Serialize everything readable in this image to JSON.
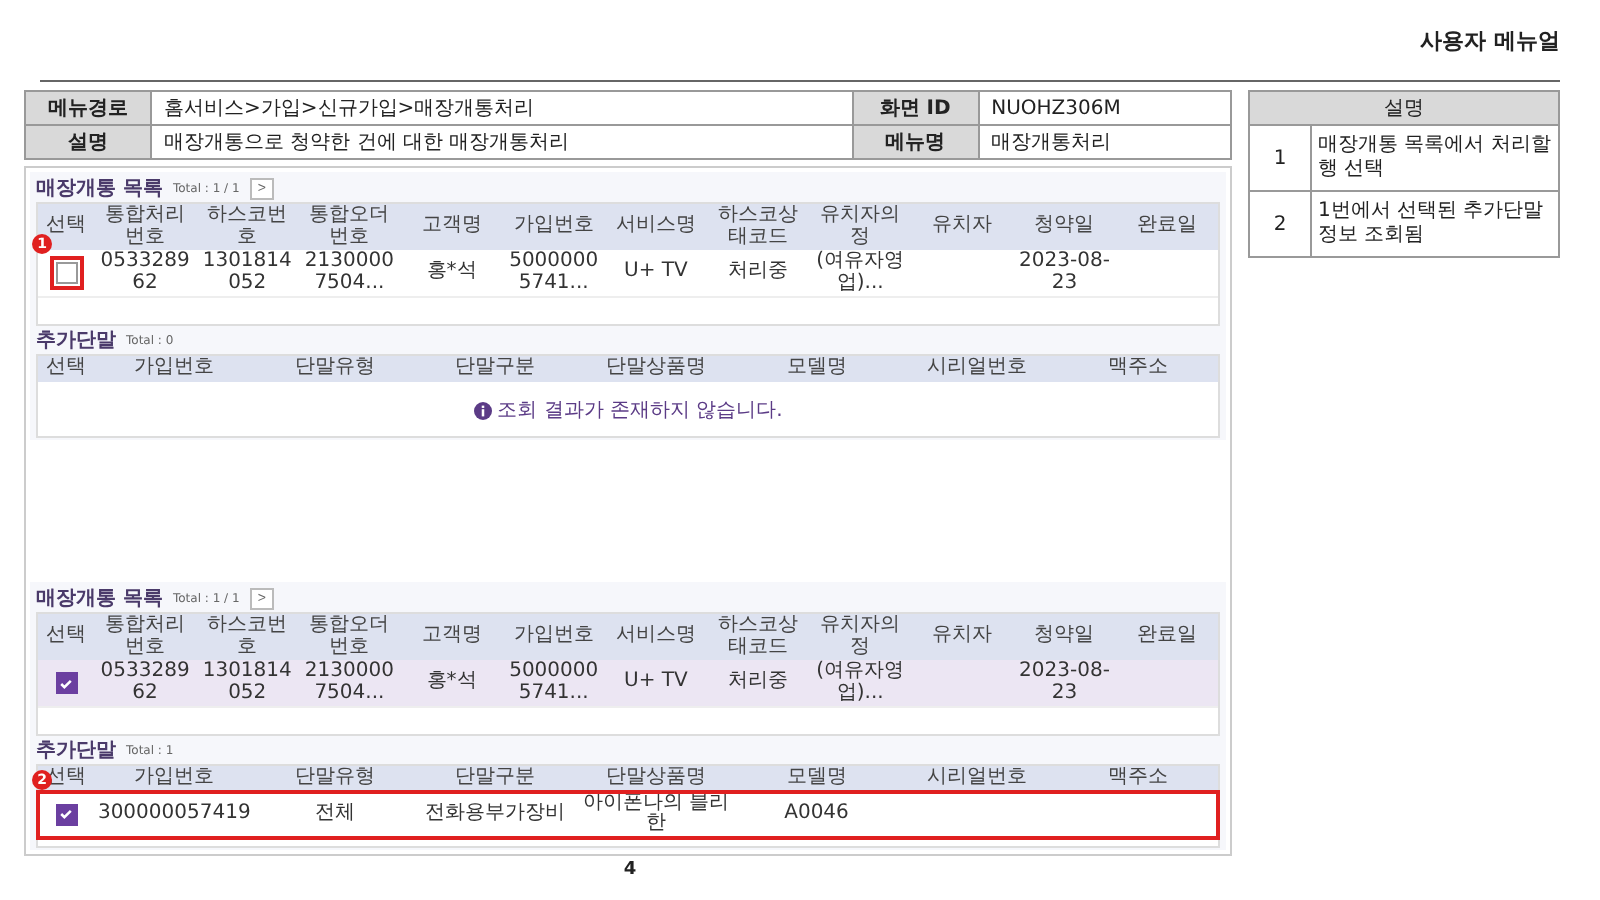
{
  "header": {
    "title": "사용자 메뉴얼"
  },
  "info": {
    "rows": [
      {
        "label": "메뉴경로",
        "value": "홈서비스>가입>신규가입>매장개통처리",
        "label2": "화면 ID",
        "value2": "NUOHZ306M"
      },
      {
        "label": "설명",
        "value": "매장개통으로 청약한 건에 대한 매장개통처리",
        "label2": "메뉴명",
        "value2": "매장개통처리"
      }
    ]
  },
  "notes": {
    "title": "설명",
    "rows": [
      {
        "number": "1",
        "text": "매장개통 목록에서 처리할 행 선택"
      },
      {
        "number": "2",
        "text": "1번에서 선택된 추가단말 정보 조회됨"
      }
    ]
  },
  "screens": [
    {
      "panels": [
        {
          "title": "매장개통 목록",
          "total": "Total : 1 / 1",
          "pager": ">",
          "columns": [
            "선택",
            "통합처리번호",
            "하스코번호",
            "통합오더번호",
            "고객명",
            "가입번호",
            "서비스명",
            "하스코상태코드",
            "유치자의정",
            "유치자",
            "청약일",
            "완료일"
          ],
          "rows": [
            {
              "checked": false,
              "selected": false,
              "checkbox_highlighted": true,
              "row_highlighted": false,
              "callout": "1",
              "cells": [
                "",
                "053328962",
                "1301814052",
                "21300007504...",
                "홍*석",
                "50000005741...",
                "U+ TV",
                "처리중",
                "(여유자영업)...",
                "",
                "2023-08-23",
                ""
              ]
            }
          ]
        },
        {
          "title": "추가단말",
          "total": "Total : 0",
          "columns": [
            "선택",
            "가입번호",
            "단말유형",
            "단말구분",
            "단말상품명",
            "모델명",
            "시리얼번호",
            "맥주소"
          ],
          "empty_message": "조회 결과가 존재하지 않습니다."
        }
      ]
    },
    {
      "panels": [
        {
          "title": "매장개통 목록",
          "total": "Total : 1 / 1",
          "pager": ">",
          "columns": [
            "선택",
            "통합처리번호",
            "하스코번호",
            "통합오더번호",
            "고객명",
            "가입번호",
            "서비스명",
            "하스코상태코드",
            "유치자의정",
            "유치자",
            "청약일",
            "완료일"
          ],
          "rows": [
            {
              "checked": true,
              "selected": true,
              "checkbox_highlighted": false,
              "row_highlighted": false,
              "cells": [
                "",
                "053328962",
                "1301814052",
                "21300007504...",
                "홍*석",
                "50000005741...",
                "U+ TV",
                "처리중",
                "(여유자영업)...",
                "",
                "2023-08-23",
                ""
              ]
            }
          ]
        },
        {
          "title": "추가단말",
          "total": "Total : 1",
          "columns": [
            "선택",
            "가입번호",
            "단말유형",
            "단말구분",
            "단말상품명",
            "모델명",
            "시리얼번호",
            "맥주소"
          ],
          "rows": [
            {
              "checked": true,
              "selected": false,
              "checkbox_highlighted": false,
              "row_highlighted": true,
              "callout": "2",
              "cells": [
                "",
                "300000057419",
                "전체",
                "전화용부가장비",
                "아이폰나의 블리한",
                "A0046",
                "",
                ""
              ]
            }
          ]
        }
      ]
    }
  ],
  "page_number": "4"
}
